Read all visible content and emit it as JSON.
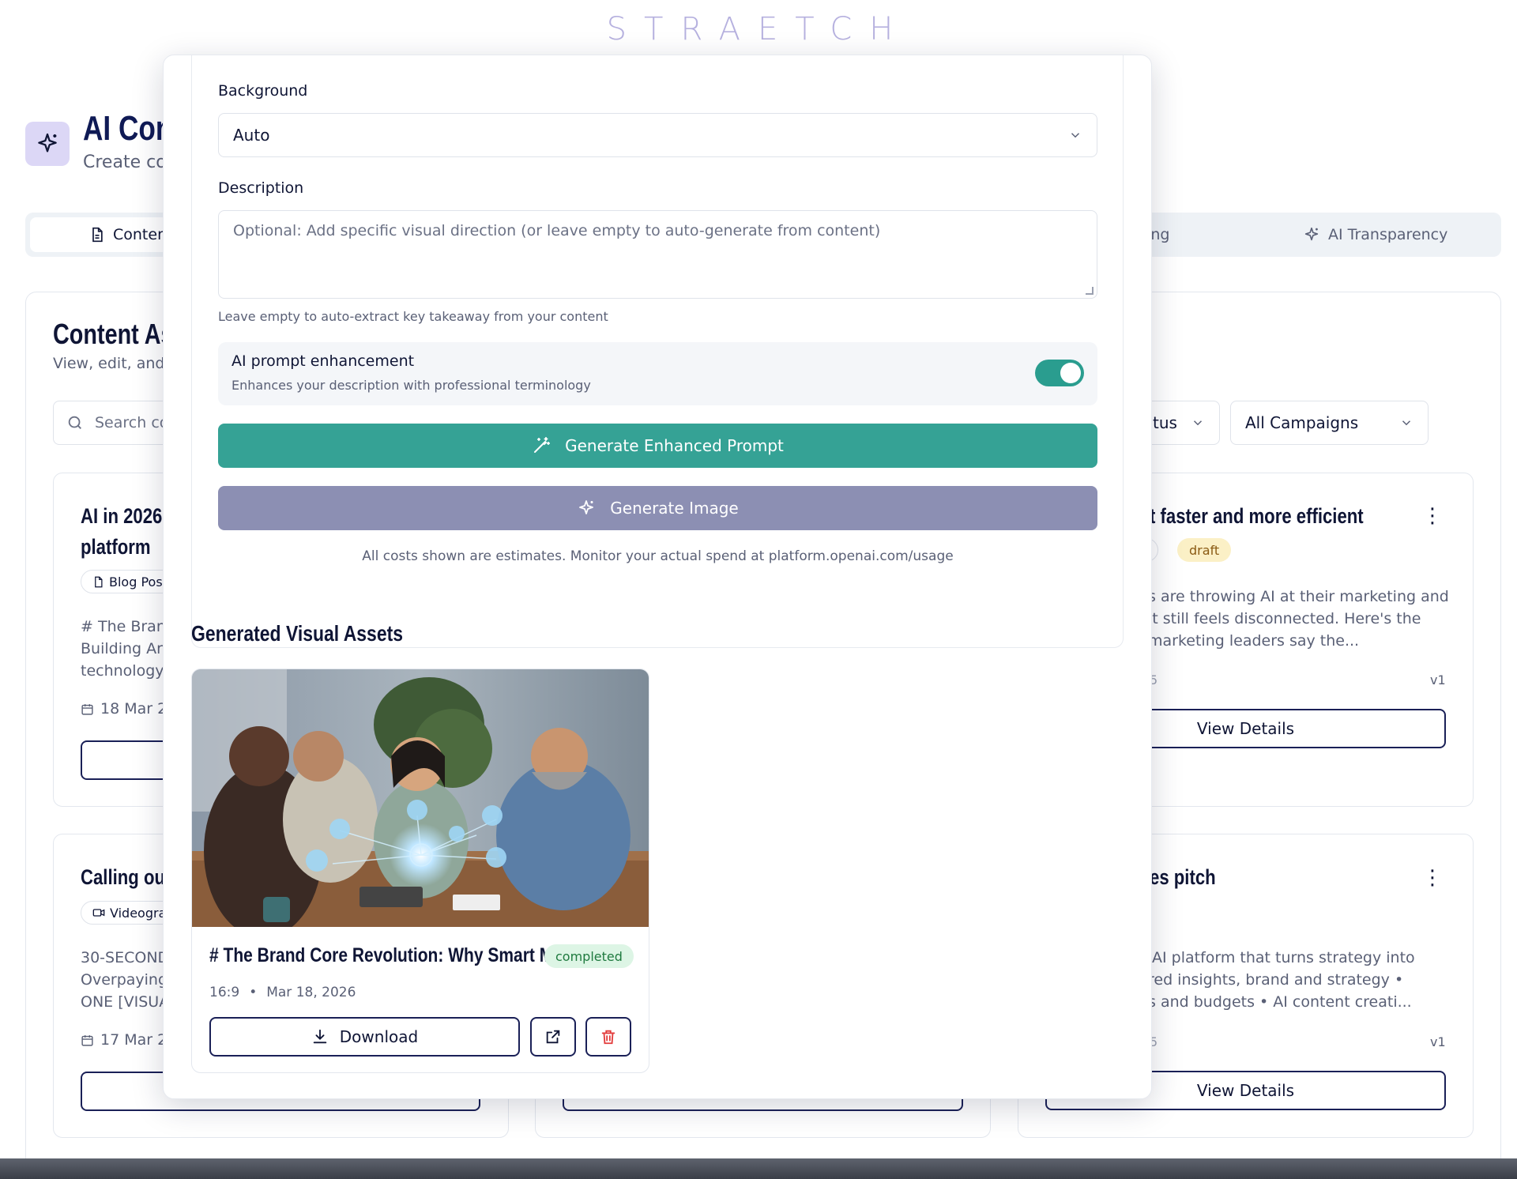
{
  "brand": {
    "logo_text": "STRAETCH"
  },
  "page": {
    "title": "AI Con",
    "subtitle": "Create cor"
  },
  "tabs": [
    {
      "label": "Conten",
      "icon": "document-icon"
    },
    {
      "label": "ning"
    },
    {
      "label": "AI Transparency",
      "icon": "sparkles-icon"
    }
  ],
  "panel": {
    "title": "Content As",
    "subtitle": "View, edit, and r",
    "search_placeholder": "Search co",
    "status_filter": "tus",
    "campaign_filter": "All Campaigns"
  },
  "cards": [
    {
      "title_lines": [
        "AI in 2026",
        "platform"
      ],
      "type_pill": "Blog Pos",
      "excerpt_lines": [
        "# The Brand",
        "Building Arc",
        "technology"
      ],
      "date": "18 Mar 20"
    },
    {
      "title": "t faster and more efficient",
      "type_pill": "t",
      "status": "draft",
      "excerpt_lines": [
        "s are throwing AI at their marketing and",
        "it still feels disconnected. Here's the",
        "marketing leaders say the..."
      ],
      "footer_left": "5",
      "version": "v1",
      "button": "View Details"
    },
    {
      "title": "Calling out",
      "type_pill": "Videogra",
      "excerpt_lines": [
        "30-SECOND",
        "Overpaying",
        "ONE [VISUA"
      ],
      "date": "17 Mar 20"
    },
    {
      "title": "es pitch",
      "excerpt_lines": [
        "AI platform that turns strategy into",
        "red insights, brand and strategy •",
        "s and budgets • AI content creati..."
      ],
      "footer_left": "5",
      "version": "v1",
      "button": "View Details"
    }
  ],
  "modal": {
    "background_label": "Background",
    "background_value": "Auto",
    "description_label": "Description",
    "description_placeholder": "Optional: Add specific visual direction (or leave empty to auto-generate from content)",
    "description_hint": "Leave empty to auto-extract key takeaway from your content",
    "enhancement_title": "AI prompt enhancement",
    "enhancement_sub": "Enhances your description with professional terminology",
    "enhancement_on": true,
    "generate_prompt_label": "Generate Enhanced Prompt",
    "generate_image_label": "Generate Image",
    "costs_note": "All costs shown are estimates. Monitor your actual spend at platform.openai.com/usage",
    "assets_title": "Generated Visual Assets",
    "asset": {
      "title": "# The Brand Core Revolution: Why Smart Mark...",
      "status": "completed",
      "ratio": "16:9",
      "date": "Mar 18, 2026",
      "download_label": "Download"
    }
  },
  "colors": {
    "accent_teal": "#35a295",
    "accent_purple": "#8c8fb3",
    "navy": "#1a2057",
    "logo": "#b6b1df"
  }
}
